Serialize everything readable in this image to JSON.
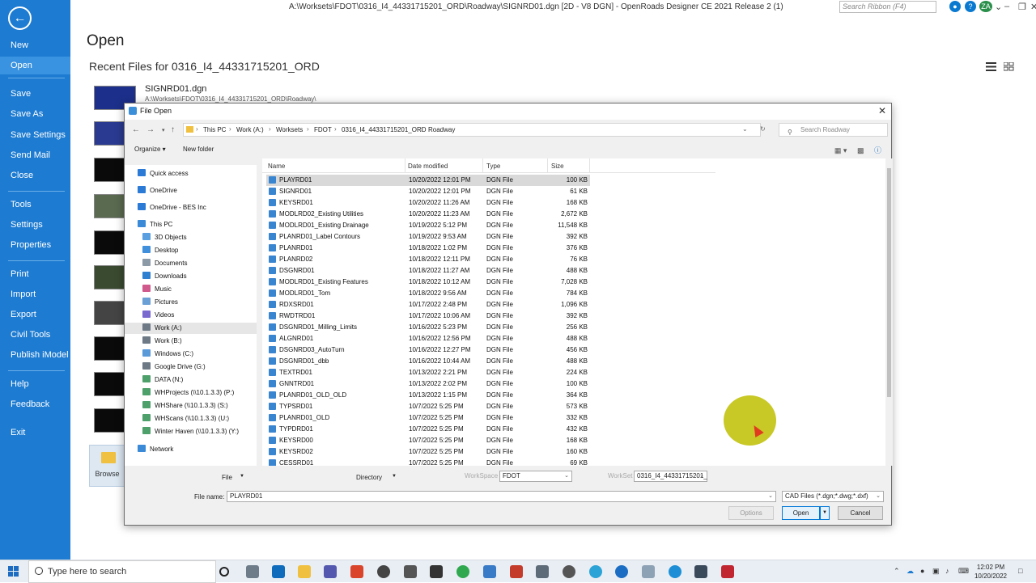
{
  "window": {
    "title": "A:\\Worksets\\FDOT\\0316_I4_44331715201_ORD\\Roadway\\SIGNRD01.dgn [2D - V8 DGN] - OpenRoads Designer CE 2021 Release 2 (1)",
    "ribbon_search_placeholder": "Search Ribbon (F4)",
    "user_initials": "ZA"
  },
  "sidebar": {
    "items": [
      {
        "label": "New"
      },
      {
        "label": "Open"
      },
      {
        "label": "Save"
      },
      {
        "label": "Save As"
      },
      {
        "label": "Save Settings"
      },
      {
        "label": "Send Mail"
      },
      {
        "label": "Close"
      },
      {
        "label": "Tools"
      },
      {
        "label": "Settings"
      },
      {
        "label": "Properties"
      },
      {
        "label": "Print"
      },
      {
        "label": "Import"
      },
      {
        "label": "Export"
      },
      {
        "label": "Civil Tools"
      },
      {
        "label": "Publish iModel"
      },
      {
        "label": "Help"
      },
      {
        "label": "Feedback"
      },
      {
        "label": "Exit"
      }
    ],
    "active": "Open"
  },
  "backstage": {
    "heading": "Open",
    "recent_heading": "Recent Files for 0316_I4_44331715201_ORD",
    "recent_file_name": "SIGNRD01.dgn",
    "recent_file_path": "A:\\Worksets\\FDOT\\0316_I4_44331715201_ORD\\Roadway\\",
    "browse_label": "Browse"
  },
  "dialog": {
    "title": "File Open",
    "breadcrumbs": [
      "This PC",
      "Work (A:)",
      "Worksets",
      "FDOT",
      "0316_I4_44331715201_ORD",
      "Roadway"
    ],
    "search_placeholder": "Search Roadway",
    "organize_label": "Organize ▾",
    "new_folder_label": "New folder",
    "nav": [
      {
        "label": "Quick access",
        "icon": "star-icon",
        "color": "#2b7ad6"
      },
      {
        "label": "OneDrive",
        "icon": "cloud-icon",
        "color": "#2b7ad6"
      },
      {
        "label": "OneDrive - BES Inc",
        "icon": "cloud-icon",
        "color": "#2b7ad6"
      },
      {
        "label": "This PC",
        "icon": "computer-icon",
        "color": "#3a8ad8"
      },
      {
        "label": "3D Objects",
        "icon": "cube-icon",
        "color": "#5aa0e0"
      },
      {
        "label": "Desktop",
        "icon": "desktop-icon",
        "color": "#3f8fdc"
      },
      {
        "label": "Documents",
        "icon": "document-icon",
        "color": "#8c9aa8"
      },
      {
        "label": "Downloads",
        "icon": "download-icon",
        "color": "#2f80d0"
      },
      {
        "label": "Music",
        "icon": "music-icon",
        "color": "#d05a8c"
      },
      {
        "label": "Pictures",
        "icon": "picture-icon",
        "color": "#6aa0d6"
      },
      {
        "label": "Videos",
        "icon": "video-icon",
        "color": "#7a6ad0"
      },
      {
        "label": "Work (A:)",
        "icon": "drive-icon",
        "color": "#6d7a86"
      },
      {
        "label": "Work (B:)",
        "icon": "drive-icon",
        "color": "#6d7a86"
      },
      {
        "label": "Windows (C:)",
        "icon": "drive-icon",
        "color": "#5a9ad8"
      },
      {
        "label": "Google Drive (G:)",
        "icon": "drive-icon",
        "color": "#6d7a86"
      },
      {
        "label": "DATA (N:)",
        "icon": "network-drive-icon",
        "color": "#4ea06a"
      },
      {
        "label": "WHProjects (\\\\10.1.3.3) (P:)",
        "icon": "network-drive-icon",
        "color": "#4ea06a"
      },
      {
        "label": "WHShare (\\\\10.1.3.3) (S:)",
        "icon": "network-drive-icon",
        "color": "#4ea06a"
      },
      {
        "label": "WHScans (\\\\10.1.3.3) (U:)",
        "icon": "network-drive-icon",
        "color": "#4ea06a"
      },
      {
        "label": "Winter Haven (\\\\10.1.3.3) (Y:)",
        "icon": "network-drive-icon",
        "color": "#4ea06a"
      },
      {
        "label": "Network",
        "icon": "network-icon",
        "color": "#3a8ad8"
      }
    ],
    "nav_selected": "Work (A:)",
    "columns": [
      "Name",
      "Date modified",
      "Type",
      "Size"
    ],
    "files": [
      {
        "name": "PLAYRD01",
        "date": "10/20/2022 12:01 PM",
        "type": "DGN File",
        "size": "100 KB"
      },
      {
        "name": "SIGNRD01",
        "date": "10/20/2022 12:01 PM",
        "type": "DGN File",
        "size": "61 KB"
      },
      {
        "name": "KEYSRD01",
        "date": "10/20/2022 11:26 AM",
        "type": "DGN File",
        "size": "168 KB"
      },
      {
        "name": "MODLRD02_Existing Utilities",
        "date": "10/20/2022 11:23 AM",
        "type": "DGN File",
        "size": "2,672 KB"
      },
      {
        "name": "MODLRD01_Existing Drainage",
        "date": "10/19/2022 5:12 PM",
        "type": "DGN File",
        "size": "11,548 KB"
      },
      {
        "name": "PLANRD01_Label Contours",
        "date": "10/19/2022 9:53 AM",
        "type": "DGN File",
        "size": "392 KB"
      },
      {
        "name": "PLANRD01",
        "date": "10/18/2022 1:02 PM",
        "type": "DGN File",
        "size": "376 KB"
      },
      {
        "name": "PLANRD02",
        "date": "10/18/2022 12:11 PM",
        "type": "DGN File",
        "size": "76 KB"
      },
      {
        "name": "DSGNRD01",
        "date": "10/18/2022 11:27 AM",
        "type": "DGN File",
        "size": "488 KB"
      },
      {
        "name": "MODLRD01_Existing Features",
        "date": "10/18/2022 10:12 AM",
        "type": "DGN File",
        "size": "7,028 KB"
      },
      {
        "name": "MODLRD01_Tom",
        "date": "10/18/2022 9:56 AM",
        "type": "DGN File",
        "size": "784 KB"
      },
      {
        "name": "RDXSRD01",
        "date": "10/17/2022 2:48 PM",
        "type": "DGN File",
        "size": "1,096 KB"
      },
      {
        "name": "RWDTRD01",
        "date": "10/17/2022 10:06 AM",
        "type": "DGN File",
        "size": "392 KB"
      },
      {
        "name": "DSGNRD01_Milling_Limits",
        "date": "10/16/2022 5:23 PM",
        "type": "DGN File",
        "size": "256 KB"
      },
      {
        "name": "ALGNRD01",
        "date": "10/16/2022 12:56 PM",
        "type": "DGN File",
        "size": "488 KB"
      },
      {
        "name": "DSGNRD03_AutoTurn",
        "date": "10/16/2022 12:27 PM",
        "type": "DGN File",
        "size": "456 KB"
      },
      {
        "name": "DSGNRD01_dbb",
        "date": "10/16/2022 10:44 AM",
        "type": "DGN File",
        "size": "488 KB"
      },
      {
        "name": "TEXTRD01",
        "date": "10/13/2022 2:21 PM",
        "type": "DGN File",
        "size": "224 KB"
      },
      {
        "name": "GNNTRD01",
        "date": "10/13/2022 2:02 PM",
        "type": "DGN File",
        "size": "100 KB"
      },
      {
        "name": "PLANRD01_OLD_OLD",
        "date": "10/13/2022 1:15 PM",
        "type": "DGN File",
        "size": "364 KB"
      },
      {
        "name": "TYPSRD01",
        "date": "10/7/2022 5:25 PM",
        "type": "DGN File",
        "size": "573 KB"
      },
      {
        "name": "PLANRD01_OLD",
        "date": "10/7/2022 5:25 PM",
        "type": "DGN File",
        "size": "332 KB"
      },
      {
        "name": "TYPDRD01",
        "date": "10/7/2022 5:25 PM",
        "type": "DGN File",
        "size": "432 KB"
      },
      {
        "name": "KEYSRD00",
        "date": "10/7/2022 5:25 PM",
        "type": "DGN File",
        "size": "168 KB"
      },
      {
        "name": "KEYSRD02",
        "date": "10/7/2022 5:25 PM",
        "type": "DGN File",
        "size": "160 KB"
      },
      {
        "name": "CESSRD01",
        "date": "10/7/2022 5:25 PM",
        "type": "DGN File",
        "size": "69 KB"
      }
    ],
    "bottom": {
      "file_menu": "File",
      "directory_menu": "Directory",
      "workspace_label": "WorkSpace",
      "workspace_value": "FDOT",
      "workset_label": "WorkSet",
      "workset_value": "0316_I4_44331715201_",
      "filename_label": "File name:",
      "filename_value": "PLAYRD01",
      "filter_value": "CAD Files (*.dgn;*.dwg;*.dxf)",
      "options_label": "Options",
      "open_label": "Open",
      "cancel_label": "Cancel"
    }
  },
  "taskbar": {
    "search_placeholder": "Type here to search",
    "time": "12:02 PM",
    "date": "10/20/2022"
  },
  "colors": {
    "sidebar": "#1d7bd1",
    "accent": "#0078d7"
  }
}
